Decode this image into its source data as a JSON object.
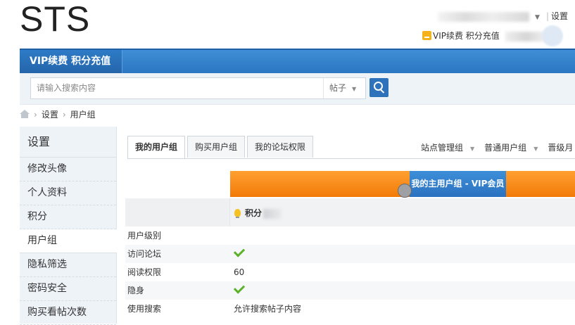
{
  "site": {
    "logo": "STS"
  },
  "top_links": {
    "settings": "设置",
    "vip": "VIP续费 积分充值"
  },
  "nav": {
    "vip_item": "VIP续费 积分充值"
  },
  "search": {
    "placeholder": "请输入搜索内容",
    "type": "帖子"
  },
  "breadcrumb": {
    "items": [
      "设置",
      "用户组"
    ]
  },
  "sidebar": {
    "title": "设置",
    "items": [
      {
        "label": "修改头像"
      },
      {
        "label": "个人资料"
      },
      {
        "label": "积分"
      },
      {
        "label": "用户组",
        "active": true
      },
      {
        "label": "隐私筛选"
      },
      {
        "label": "密码安全"
      },
      {
        "label": "购买看帖次数"
      }
    ]
  },
  "tabs": [
    {
      "label": "我的用户组",
      "active": true
    },
    {
      "label": "购买用户组"
    },
    {
      "label": "我的论坛权限"
    }
  ],
  "group_links": [
    "站点管理组",
    "普通用户组",
    "晋级月"
  ],
  "group_header": {
    "main_group": "我的主用户组 - VIP会员",
    "points_label": "积分"
  },
  "permissions": [
    {
      "label": "用户级别",
      "value": ""
    },
    {
      "label": "访问论坛",
      "value": "",
      "check": true
    },
    {
      "label": "阅读权限",
      "value": "60"
    },
    {
      "label": "隐身",
      "value": "",
      "check": true
    },
    {
      "label": "使用搜索",
      "value": "允许搜索帖子内容"
    }
  ],
  "colors": {
    "nav_blue": "#2c76c2",
    "orange": "#f27a08",
    "check_green": "#5bb12a"
  }
}
